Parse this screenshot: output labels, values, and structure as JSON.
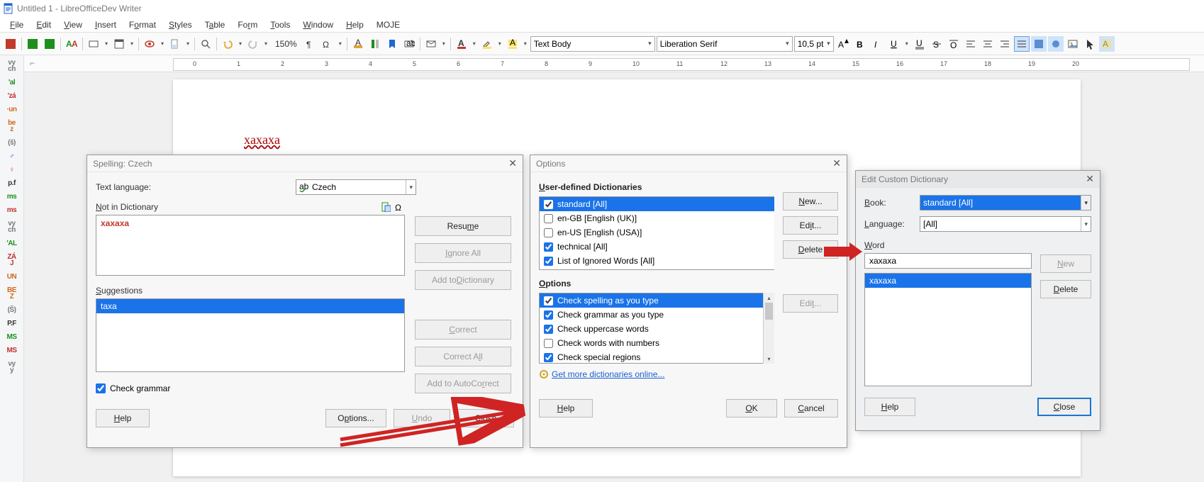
{
  "window": {
    "title": "Untitled 1 - LibreOfficeDev Writer"
  },
  "menu": {
    "items": [
      "File",
      "Edit",
      "View",
      "Insert",
      "Format",
      "Styles",
      "Table",
      "Form",
      "Tools",
      "Window",
      "Help",
      "MOJE"
    ]
  },
  "toolbar": {
    "zoom": "150%",
    "style": "Text Body",
    "font": "Liberation Serif",
    "size": "10,5 pt"
  },
  "document": {
    "word": "xaxaxa"
  },
  "sidebar": {
    "chips": [
      {
        "t": "vy\nch",
        "c": "#7a7a7a"
      },
      {
        "t": "'al",
        "c": "#1d8f1d"
      },
      {
        "t": "'zá",
        "c": "#c03030"
      },
      {
        "t": "·un",
        "c": "#d06a1d"
      },
      {
        "t": "be\nz",
        "c": "#d06a1d"
      },
      {
        "t": "(š)",
        "c": "#7a7a7a"
      },
      {
        "t": "♂",
        "c": "#1e66d0"
      },
      {
        "t": "♀",
        "c": "#c22f7d"
      },
      {
        "t": "p.f",
        "c": "#333333"
      },
      {
        "t": "ms",
        "c": "#1d8f1d"
      },
      {
        "t": "ms",
        "c": "#c03030"
      },
      {
        "t": "vy\nch",
        "c": "#7a7a7a"
      },
      {
        "t": "'AL",
        "c": "#1d8f1d"
      },
      {
        "t": "ZÁ\nJ",
        "c": "#c03030"
      },
      {
        "t": "UN",
        "c": "#d06a1d"
      },
      {
        "t": "BE\nZ",
        "c": "#d06a1d"
      },
      {
        "t": "(Š)",
        "c": "#7a7a7a"
      },
      {
        "t": "P.F",
        "c": "#333333"
      },
      {
        "t": "MS",
        "c": "#1d8f1d"
      },
      {
        "t": "MS",
        "c": "#c03030"
      },
      {
        "t": "vy\ny",
        "c": "#7a7a7a"
      }
    ]
  },
  "spelling": {
    "title": "Spelling: Czech",
    "text_language_label": "Text language:",
    "language": "Czech",
    "not_in_dict_label": "Not in Dictionary",
    "word": "xaxaxa",
    "suggestions_label": "Suggestions",
    "suggestions": [
      "taxa"
    ],
    "check_grammar": "Check grammar",
    "buttons": {
      "resume": "Resume",
      "ignore_all": "Ignore All",
      "add_to_dict": "Add to Dictionary",
      "correct": "Correct",
      "correct_all": "Correct All",
      "add_autocorrect": "Add to AutoCorrect",
      "help": "Help",
      "options": "Options...",
      "undo": "Undo",
      "close": "Close"
    }
  },
  "options": {
    "title": "Options",
    "section_dict": "User-defined Dictionaries",
    "dicts": [
      {
        "label": "standard [All]",
        "checked": true,
        "sel": true
      },
      {
        "label": "en-GB [English (UK)]",
        "checked": false,
        "sel": false
      },
      {
        "label": "en-US [English (USA)]",
        "checked": false,
        "sel": false
      },
      {
        "label": "technical [All]",
        "checked": true,
        "sel": false
      },
      {
        "label": "List of Ignored Words [All]",
        "checked": true,
        "sel": false
      }
    ],
    "section_opts": "Options",
    "opts": [
      {
        "label": "Check spelling as you type",
        "checked": true,
        "sel": true
      },
      {
        "label": "Check grammar as you type",
        "checked": true,
        "sel": false
      },
      {
        "label": "Check uppercase words",
        "checked": true,
        "sel": false
      },
      {
        "label": "Check words with numbers",
        "checked": false,
        "sel": false
      },
      {
        "label": "Check special regions",
        "checked": true,
        "sel": false
      }
    ],
    "link": "Get more dictionaries online...",
    "buttons": {
      "new": "New...",
      "edit": "Edit...",
      "delete": "Delete",
      "edit2": "Edit...",
      "help": "Help",
      "ok": "OK",
      "cancel": "Cancel"
    }
  },
  "custom": {
    "title": "Edit Custom Dictionary",
    "book_label": "Book:",
    "book": "standard [All]",
    "language_label": "Language:",
    "language": "[All]",
    "word_label": "Word",
    "word": "xaxaxa",
    "list": [
      "xaxaxa"
    ],
    "buttons": {
      "new": "New",
      "delete": "Delete",
      "help": "Help",
      "close": "Close"
    }
  }
}
